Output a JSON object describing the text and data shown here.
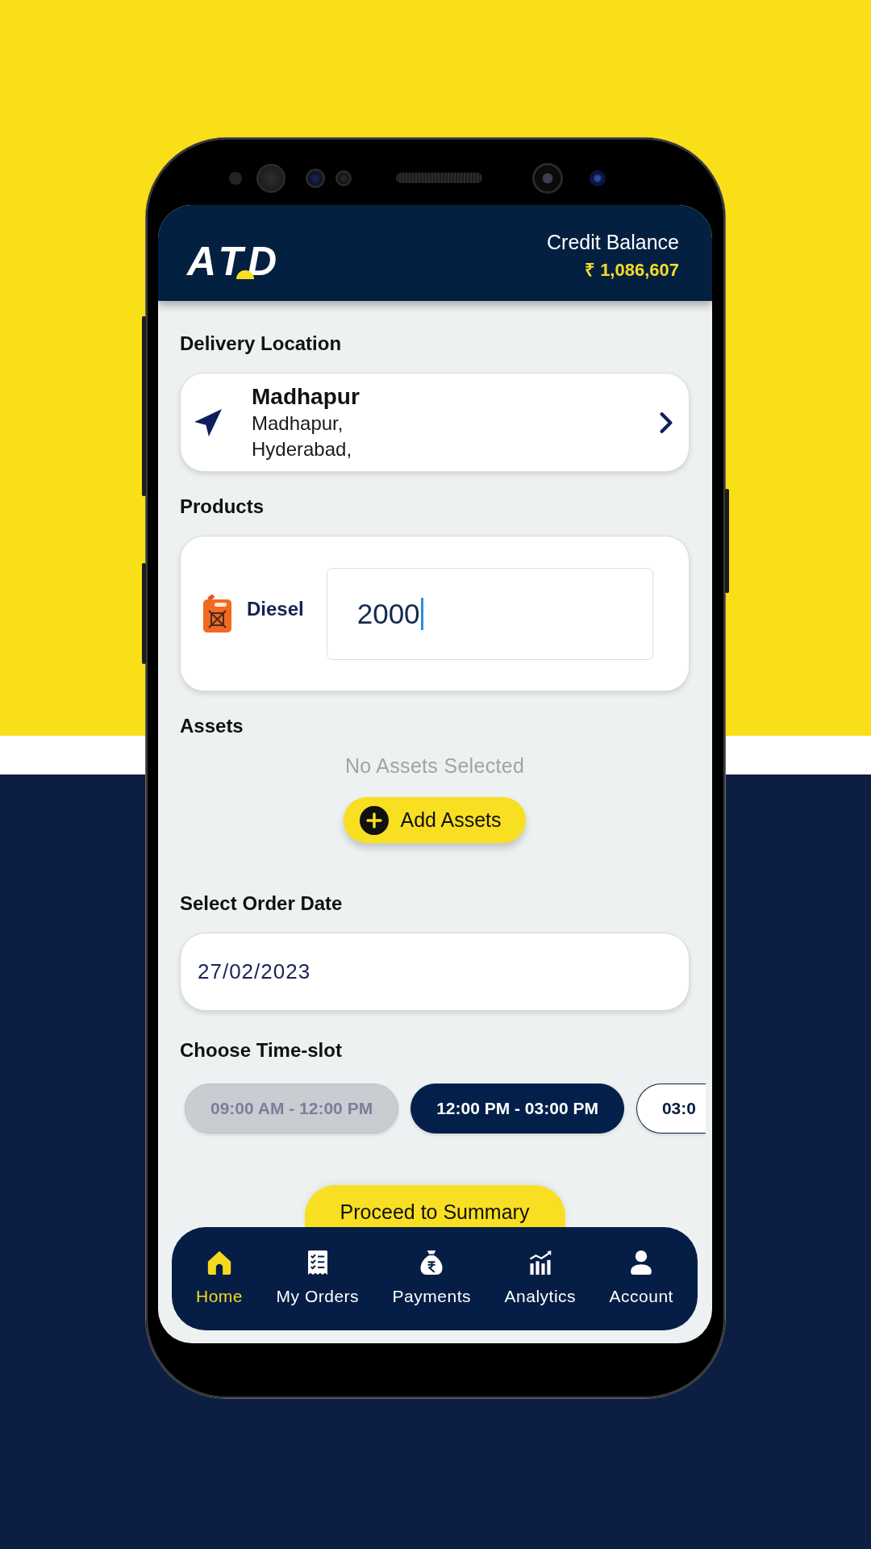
{
  "header": {
    "logo": "ATD",
    "credit_label": "Credit Balance",
    "credit_amount": "₹ 1,086,607"
  },
  "delivery": {
    "label": "Delivery Location",
    "title": "Madhapur",
    "address_lines": [
      "Madhapur,",
      "Hyderabad,"
    ]
  },
  "products": {
    "label": "Products",
    "items": [
      {
        "name": "Diesel",
        "value": "2000",
        "focused": true
      }
    ]
  },
  "assets": {
    "label": "Assets",
    "empty_text": "No Assets Selected",
    "add_button": "Add Assets"
  },
  "order_date": {
    "label": "Select Order Date",
    "value": "27/02/2023"
  },
  "time_slots": {
    "label": "Choose Time-slot",
    "slots": [
      {
        "label": "09:00 AM - 12:00 PM",
        "disabled": true,
        "selected": false
      },
      {
        "label": "12:00 PM - 03:00 PM",
        "disabled": false,
        "selected": true
      },
      {
        "label": "03:0",
        "disabled": false,
        "selected": false
      }
    ]
  },
  "proceed_button": "Proceed to Summary",
  "bottom_nav": [
    {
      "label": "Home",
      "selected": true
    },
    {
      "label": "My Orders",
      "selected": false
    },
    {
      "label": "Payments",
      "selected": false
    },
    {
      "label": "Analytics",
      "selected": false
    },
    {
      "label": "Account",
      "selected": false
    }
  ]
}
